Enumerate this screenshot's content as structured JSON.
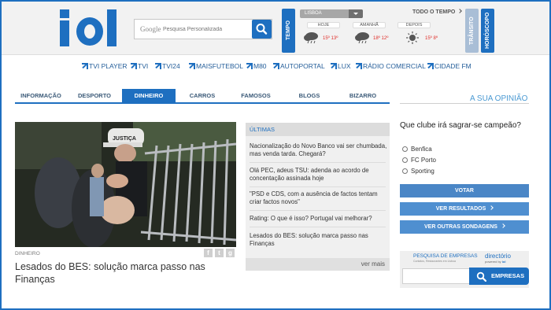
{
  "brand": {
    "logo_text": "iol",
    "color": "#1e6fc0"
  },
  "search": {
    "provider": "Google",
    "placeholder": "Pesquisa Personalizada",
    "icon": "search-icon"
  },
  "weather": {
    "tab_label": "TEMPO",
    "city": "LISBOA",
    "all_link": "TODO O TEMPO",
    "days": [
      {
        "label": "HOJE",
        "icon": "rain-cloud-icon",
        "min": "15º",
        "max": "13º"
      },
      {
        "label": "AMANHÃ",
        "icon": "rain-cloud-icon",
        "min": "18º",
        "max": "12º"
      },
      {
        "label": "DEPOIS",
        "icon": "sun-icon",
        "min": "15º",
        "max": "8º"
      }
    ]
  },
  "side_tabs": {
    "transit": "TRÂNSITO",
    "horoscope": "HORÓSCOPO"
  },
  "channels": [
    "TVI PLAYER",
    "TVI",
    "TVI24",
    "MAISFUTEBOL",
    "M80",
    "AUTOPORTAL",
    "LUX",
    "RÁDIO COMERCIAL",
    "CIDADE FM"
  ],
  "sections": {
    "items": [
      "INFORMAÇÃO",
      "DESPORTO",
      "DINHEIRO",
      "CARROS",
      "FAMOSOS",
      "BLOGS",
      "BIZARRO"
    ],
    "active": "DINHEIRO"
  },
  "article": {
    "category": "DINHEIRO",
    "headline": "Lesados do BES: solução marca passo nas Finanças",
    "image_caption_text": "JUSTIÇA"
  },
  "latest": {
    "header": "ÚLTIMAS",
    "items": [
      "Nacionalização do Novo Banco vai ser chumbada, mas venda tarda. Chegará?",
      "Olá PEC, adeus TSU: adenda ao acordo de concentação assinada hoje",
      "\"PSD e CDS, com a ausência de factos tentam criar factos novos\"",
      "Rating: O que é isso? Portugal vai melhorar?",
      "Lesados do BES: solução marca passo nas Finanças"
    ],
    "more": "ver mais"
  },
  "poll": {
    "header": "A SUA OPINIÃO",
    "question": "Que clube irá sagrar-se campeão?",
    "options": [
      "Benfica",
      "FC Porto",
      "Sporting"
    ],
    "vote": "VOTAR",
    "results": "VER RESULTADOS",
    "other": "VER OUTRAS SONDAGENS"
  },
  "companies": {
    "title": "PESQUISA DE EMPRESAS",
    "subtitle": "Contatos, Restaurantes em Lisboa",
    "directory": "directório",
    "directory_sub": "powered by",
    "directory_brand": "iol",
    "button": "EMPRESAS"
  }
}
